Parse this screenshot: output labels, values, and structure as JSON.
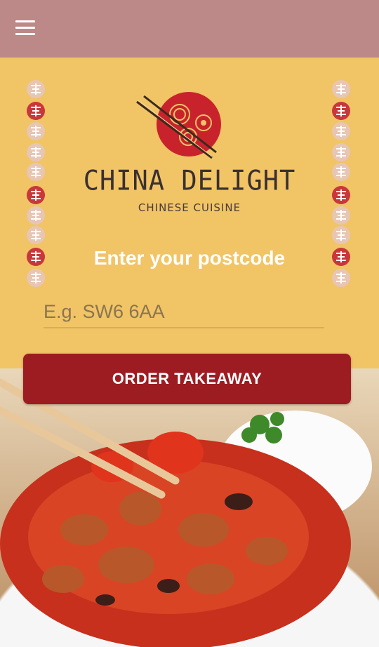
{
  "header": {
    "menu_icon": "hamburger-menu-icon"
  },
  "brand": {
    "name": "CHINA DELIGHT",
    "tagline": "CHINESE CUISINE",
    "logo_icon": "bowl-chopsticks-logo"
  },
  "postcode": {
    "title": "Enter your postcode",
    "placeholder": "E.g. SW6 6AA",
    "value": ""
  },
  "order": {
    "button_label": "ORDER TAKEAWAY"
  },
  "colors": {
    "topbar": "#bc8988",
    "background": "#f1c466",
    "accent": "#9d1c22",
    "seal_red": "#c8373b"
  }
}
